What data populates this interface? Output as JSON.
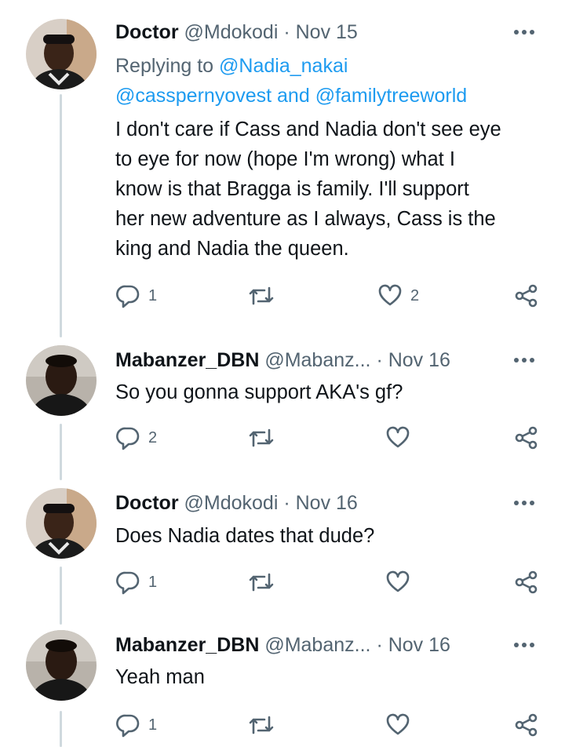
{
  "tweets": [
    {
      "name": "Doctor",
      "handle": "@Mdokodi",
      "dot": "·",
      "date": "Nov 15",
      "replying_prefix": "Replying to ",
      "replying_user": "@Nadia_nakai",
      "replying_line2_user1": "@casspernyovest",
      "replying_line2_and": " and ",
      "replying_line2_user2": "@familytreeworld",
      "lines": [
        "I don't care if Cass and Nadia don't see eye",
        "to eye for now (hope I'm wrong) what I",
        "know is that Bragga is family. I'll support",
        "her new adventure as I always, Cass is the",
        "king and Nadia the queen."
      ],
      "reply_count": "1",
      "retweet_count": "",
      "like_count": "2"
    },
    {
      "name": "Mabanzer_DBN",
      "handle": "@Mabanz...",
      "dot": "·",
      "date": "Nov 16",
      "lines": [
        "So you gonna support AKA's gf?"
      ],
      "reply_count": "2",
      "retweet_count": "",
      "like_count": ""
    },
    {
      "name": "Doctor",
      "handle": "@Mdokodi",
      "dot": "·",
      "date": "Nov 16",
      "lines": [
        "Does Nadia dates that dude?"
      ],
      "reply_count": "1",
      "retweet_count": "",
      "like_count": ""
    },
    {
      "name": "Mabanzer_DBN",
      "handle": "@Mabanz...",
      "dot": "·",
      "date": "Nov 16",
      "lines": [
        "Yeah man"
      ],
      "reply_count": "1",
      "retweet_count": "",
      "like_count": ""
    }
  ],
  "icons": {
    "more": "more-icon",
    "reply": "reply-icon",
    "retweet": "retweet-icon",
    "like": "heart-icon",
    "share": "share-icon"
  },
  "colors": {
    "text": "#0f1419",
    "secondary": "#536471",
    "link": "#1d9bf0",
    "thread_line": "#cfd9de"
  }
}
